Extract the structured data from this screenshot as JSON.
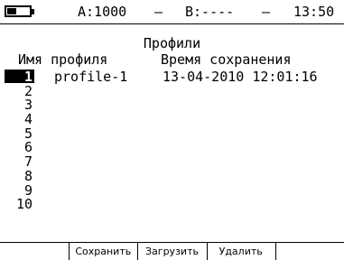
{
  "status_bar": {
    "channel_a": "A:1000",
    "sep1": "–",
    "channel_b": "B:----",
    "sep2": "–",
    "time": "13:50",
    "battery_level": 0.4
  },
  "screen": {
    "title": "Профили",
    "columns": {
      "name": "Имя профиля",
      "saved_time": "Время сохранения"
    }
  },
  "profiles": [
    {
      "num": "1",
      "name": "profile-1",
      "saved": "13-04-2010 12:01:16",
      "selected": true
    },
    {
      "num": "2",
      "name": "",
      "saved": ""
    },
    {
      "num": "3",
      "name": "",
      "saved": ""
    },
    {
      "num": "4",
      "name": "",
      "saved": ""
    },
    {
      "num": "5",
      "name": "",
      "saved": ""
    },
    {
      "num": "6",
      "name": "",
      "saved": ""
    },
    {
      "num": "7",
      "name": "",
      "saved": ""
    },
    {
      "num": "8",
      "name": "",
      "saved": ""
    },
    {
      "num": "9",
      "name": "",
      "saved": ""
    },
    {
      "num": "10",
      "name": "",
      "saved": ""
    }
  ],
  "softkeys": [
    "",
    "Сохранить",
    "Загрузить",
    "Удалить",
    ""
  ]
}
